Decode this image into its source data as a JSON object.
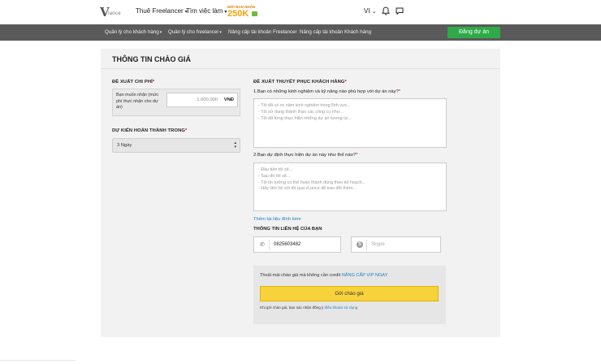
{
  "header": {
    "logo_text": "lance",
    "logo_mark": "V",
    "nav": [
      {
        "label": "Thuê Freelancer"
      },
      {
        "label": "Tìm việc làm"
      }
    ],
    "promo_small": "MỜI BẠN NHẬN",
    "promo_big": "250K",
    "language": "VI",
    "icons": [
      "bell-icon",
      "message-icon"
    ]
  },
  "subnav": {
    "items": [
      {
        "label": "Quản lý cho khách hàng"
      },
      {
        "label": "Quản lý cho freelancer"
      },
      {
        "label": "Nâng cấp tài khoản Freelancer"
      },
      {
        "label": "Nâng cấp tài khoản Khách hàng"
      }
    ],
    "post_button": "Đăng dự án"
  },
  "form": {
    "title": "THÔNG TIN CHÀO GIÁ",
    "bid": {
      "label": "ĐỀ XUẤT CHI PHÍ",
      "required_mark": "*",
      "description": "Bạn muốn nhận (mức phí thực nhận cho dự án)",
      "value": "1.000.000",
      "currency": "VNĐ"
    },
    "duration": {
      "label": "DỰ KIẾN HOÀN THÀNH TRONG",
      "required_mark": "*",
      "selected": "3 Ngày"
    },
    "proposal": {
      "label": "ĐỀ XUẤT THUYẾT PHỤC KHÁCH HÀNG",
      "required_mark": "*",
      "q1": "1.Bạn có những kinh nghiệm và kỹ năng nào phù hợp với dự án này?",
      "q1_placeholder": [
        "- Tôi đã có xx năm kinh nghiệm trong lĩnh vực...",
        "- Tôi sử dụng thành thạo các công cụ như...",
        "- Tôi đã từng thực hiện những dự án tương tự..."
      ],
      "q2": "2.Bạn dự định thực hiện dự án này như thế nào?",
      "q2_placeholder": [
        "- Đầu tiên tôi sẽ...",
        "- Sau đó tôi sẽ...",
        "- Tôi tin tưởng có thể hoàn thành đúng theo kế hoạch...",
        "- Hãy liên hệ với tôi qua vLance để trao đổi thêm..."
      ],
      "attach_link": "Thêm tài liệu đính kèm"
    },
    "contact": {
      "label": "THÔNG TIN LIÊN HỆ CỦA BẠN",
      "phone": "0825603482",
      "skype_placeholder": "Skype"
    },
    "vip": {
      "note": "Thoải mái chào giá mà không cần credit",
      "note_link": "NÂNG CẤP VIP NGAY",
      "submit": "Gởi chào giá",
      "terms": "Khi gởi chào giá, bạn sác nhận đồng ý",
      "terms_link": "điều khoản sử dụng"
    }
  }
}
